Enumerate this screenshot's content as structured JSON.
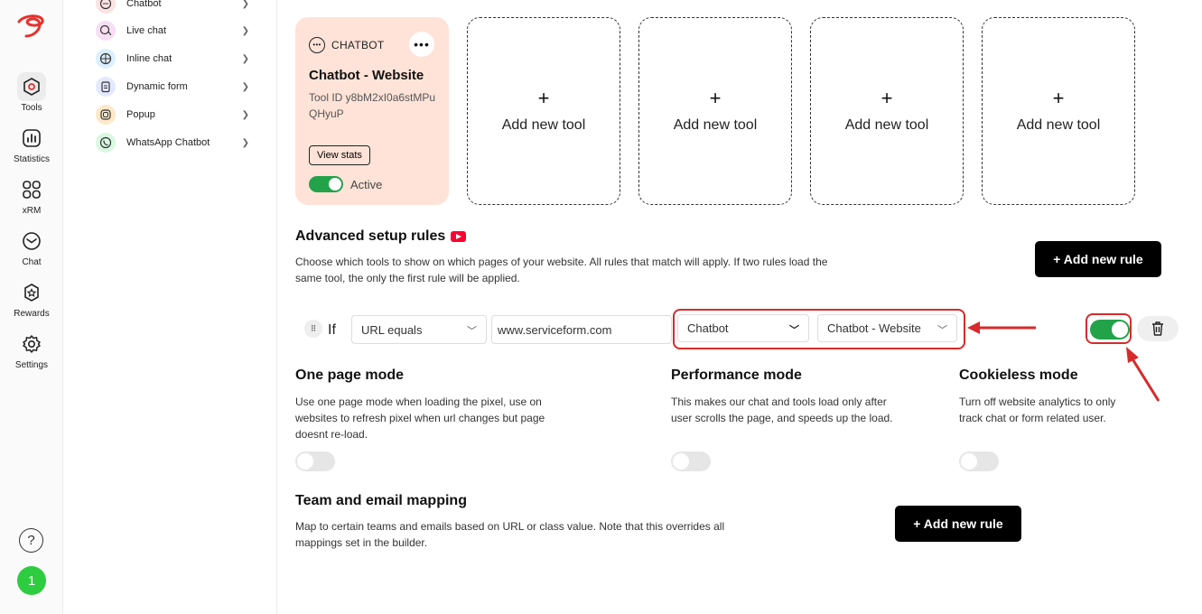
{
  "rail": {
    "items": [
      {
        "label": "Tools",
        "icon": "tools-icon"
      },
      {
        "label": "Statistics",
        "icon": "statistics-icon"
      },
      {
        "label": "xRM",
        "icon": "xrm-icon"
      },
      {
        "label": "Chat",
        "icon": "chat-icon"
      },
      {
        "label": "Rewards",
        "icon": "rewards-icon"
      },
      {
        "label": "Settings",
        "icon": "settings-icon"
      }
    ],
    "help": "?",
    "avatar": "1"
  },
  "toollist": {
    "items": [
      {
        "label": "Chatbot",
        "icon": "chatbot-icon",
        "color": "#fde2e2"
      },
      {
        "label": "Live chat",
        "icon": "live-chat-icon",
        "color": "#f6def3"
      },
      {
        "label": "Inline chat",
        "icon": "inline-chat-icon",
        "color": "#dcefff"
      },
      {
        "label": "Dynamic form",
        "icon": "dynamic-form-icon",
        "color": "#e4e9ff"
      },
      {
        "label": "Popup",
        "icon": "popup-icon",
        "color": "#fde9c8"
      },
      {
        "label": "WhatsApp Chatbot",
        "icon": "whatsapp-icon",
        "color": "#d9f7e1"
      }
    ]
  },
  "tool_card": {
    "type": "CHATBOT",
    "menu": "•••",
    "title": "Chatbot - Website",
    "tool_id": "Tool ID y8bM2xI0a6stMPuQHyuP",
    "view_stats": "View stats",
    "status": "Active",
    "background": "#ffe3d8"
  },
  "add_tool": {
    "plus": "+",
    "label": "Add new tool"
  },
  "advanced": {
    "title": "Advanced setup rules",
    "description": "Choose which tools to show on which pages of your website. All rules that match will apply. If two rules load the same tool, the only the first rule will be applied.",
    "add_rule": "+ Add new rule"
  },
  "rule": {
    "drag": "⠿",
    "if": "If",
    "condition": "URL equals",
    "url": "www.serviceform.com",
    "tool_type": "Chatbot",
    "tool_name": "Chatbot - Website",
    "enabled": true
  },
  "modes": {
    "one_page": {
      "title": "One page mode",
      "description": "Use one page mode when loading the pixel, use on websites to refresh pixel when url changes but page doesnt re-load."
    },
    "performance": {
      "title": "Performance mode",
      "description": "This makes our chat and tools load only after user scrolls the page, and speeds up the load."
    },
    "cookieless": {
      "title": "Cookieless mode",
      "description": "Turn off website analytics to only track chat or form related user."
    }
  },
  "team_mapping": {
    "title": "Team and email mapping",
    "description": "Map to certain teams and emails based on URL or class value. Note that this overrides all mappings set in the builder.",
    "add_rule": "+ Add new rule"
  },
  "colors": {
    "accent_green": "#22a34a",
    "annotation_red": "#d62b2b",
    "brand_red": "#e8302c"
  }
}
